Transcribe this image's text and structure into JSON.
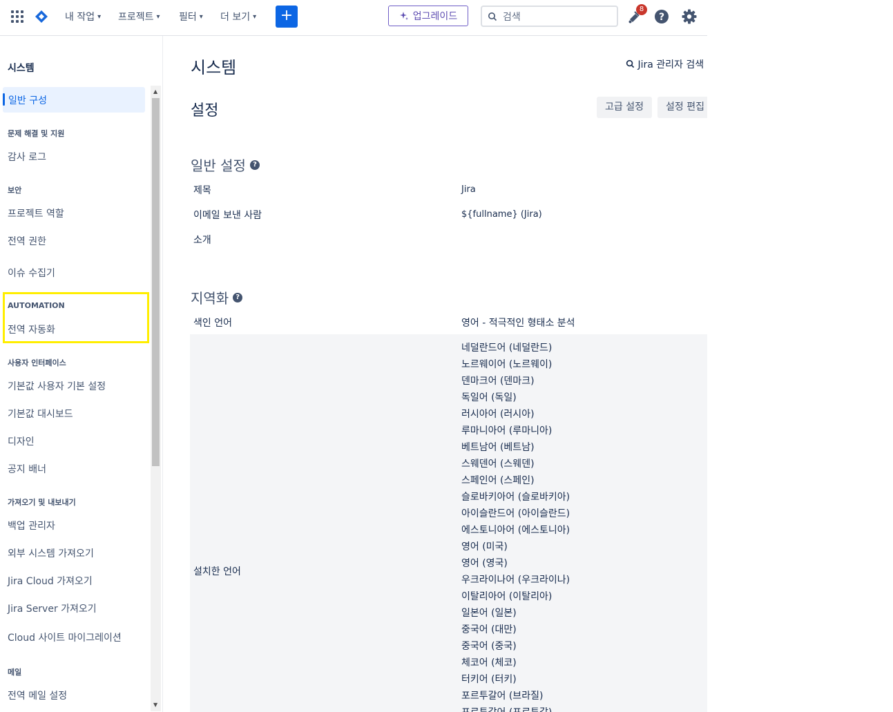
{
  "topnav": {
    "menus": [
      "내 작업",
      "프로젝트",
      "필터",
      "더 보기"
    ],
    "upgrade_label": "업그레이드",
    "search_placeholder": "검색",
    "notification_count": "8",
    "colors": {
      "primary": "#0c66e4",
      "upgrade": "#6e5dc6",
      "badge": "#c9372c"
    }
  },
  "sidebar": {
    "title": "시스템",
    "active_item": "일반 구성",
    "sections": [
      {
        "heading": "문제 해결 및 지원",
        "items": [
          "감사 로그"
        ]
      },
      {
        "heading": "보안",
        "items": [
          "프로젝트 역할",
          "전역 권한",
          "이슈 수집기"
        ]
      },
      {
        "heading": "AUTOMATION",
        "items": [
          "전역 자동화"
        ]
      },
      {
        "heading": "사용자 인터페이스",
        "items": [
          "기본값 사용자 기본 설정",
          "기본값 대시보드",
          "디자인",
          "공지 배너"
        ]
      },
      {
        "heading": "가져오기 및 내보내기",
        "items": [
          "백업 관리자",
          "외부 시스템 가져오기",
          "Jira Cloud 가져오기",
          "Jira Server 가져오기",
          "Cloud 사이트 마이그레이션"
        ]
      },
      {
        "heading": "메일",
        "items": [
          "전역 메일 설정"
        ]
      }
    ],
    "highlight_color": "#ffee00"
  },
  "main": {
    "page_title": "시스템",
    "admin_search": "Jira 관리자 검색",
    "settings_title": "설정",
    "buttons": {
      "advanced": "고급 설정",
      "edit": "설정 편집"
    },
    "general": {
      "title": "일반 설정",
      "rows": [
        {
          "label": "제목",
          "value": "Jira"
        },
        {
          "label": "이메일 보낸 사람",
          "value": "${fullname} (Jira)"
        },
        {
          "label": "소개",
          "value": ""
        }
      ]
    },
    "localization": {
      "title": "지역화",
      "index_label": "색인 언어",
      "index_value": "영어 - 적극적인 형태소 분석",
      "installed_label": "설치한 언어",
      "languages": [
        "네덜란드어 (네덜란드)",
        "노르웨이어 (노르웨이)",
        "덴마크어 (덴마크)",
        "독일어 (독일)",
        "러시아어 (러시아)",
        "루마니아어 (루마니아)",
        "베트남어 (베트남)",
        "스웨덴어 (스웨덴)",
        "스페인어 (스페인)",
        "슬로바키아어 (슬로바키아)",
        "아이슬란드어 (아이슬란드)",
        "에스토니아어 (에스토니아)",
        "영어 (미국)",
        "영어 (영국)",
        "우크라이나어 (우크라이나)",
        "이탈리아어 (이탈리아)",
        "일본어 (일본)",
        "중국어 (대만)",
        "중국어 (중국)",
        "체코어 (체코)",
        "터키어 (터키)",
        "포르투갈어 (브라질)",
        "포르투갈어 (포르투갈)"
      ]
    }
  }
}
